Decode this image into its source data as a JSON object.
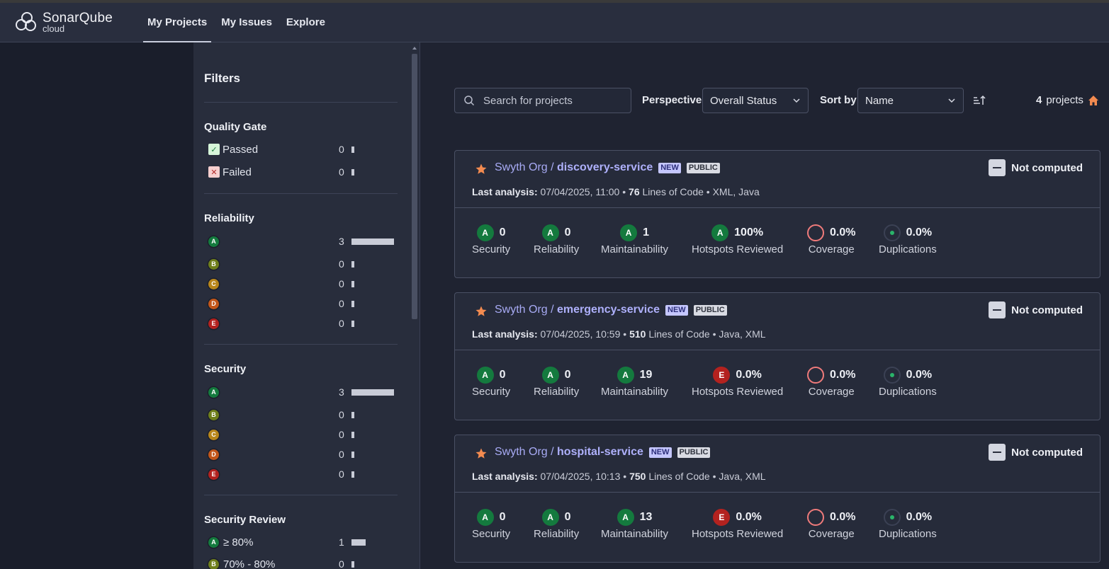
{
  "app": {
    "name": "SonarQube",
    "sub": "cloud"
  },
  "nav": [
    {
      "label": "My Projects",
      "active": true
    },
    {
      "label": "My Issues",
      "active": false
    },
    {
      "label": "Explore",
      "active": false
    }
  ],
  "filters": {
    "title": "Filters",
    "quality_gate": {
      "title": "Quality Gate",
      "items": [
        {
          "label": "Passed",
          "count": "0",
          "fraction": 0
        },
        {
          "label": "Failed",
          "count": "0",
          "fraction": 0
        }
      ]
    },
    "reliability": {
      "title": "Reliability",
      "items": [
        {
          "grade": "A",
          "count": "3",
          "fraction": 1
        },
        {
          "grade": "B",
          "count": "0",
          "fraction": 0
        },
        {
          "grade": "C",
          "count": "0",
          "fraction": 0
        },
        {
          "grade": "D",
          "count": "0",
          "fraction": 0
        },
        {
          "grade": "E",
          "count": "0",
          "fraction": 0
        }
      ]
    },
    "security": {
      "title": "Security",
      "items": [
        {
          "grade": "A",
          "count": "3",
          "fraction": 1
        },
        {
          "grade": "B",
          "count": "0",
          "fraction": 0
        },
        {
          "grade": "C",
          "count": "0",
          "fraction": 0
        },
        {
          "grade": "D",
          "count": "0",
          "fraction": 0
        },
        {
          "grade": "E",
          "count": "0",
          "fraction": 0
        }
      ]
    },
    "security_review": {
      "title": "Security Review",
      "items": [
        {
          "grade": "A",
          "label": "≥ 80%",
          "count": "1",
          "fraction": 0.33
        },
        {
          "grade": "B",
          "label": "70% - 80%",
          "count": "0",
          "fraction": 0
        }
      ]
    }
  },
  "toolbar": {
    "search_placeholder": "Search for projects",
    "perspective_label": "Perspective",
    "perspective_value": "Overall Status",
    "sort_label": "Sort by",
    "sort_value": "Name",
    "count_value": "4",
    "count_suffix": "projects"
  },
  "projects": [
    {
      "org": "Swyth Org",
      "name": "discovery-service",
      "tags": [
        "NEW",
        "PUBLIC"
      ],
      "status": "Not computed",
      "analysis_label": "Last analysis:",
      "analysis_date": "07/04/2025, 11:00",
      "loc": "76",
      "loc_label": "Lines of Code",
      "languages": "XML, Java",
      "security": {
        "grade": "A",
        "value": "0",
        "label": "Security"
      },
      "reliability": {
        "grade": "A",
        "value": "0",
        "label": "Reliability"
      },
      "maintainability": {
        "grade": "A",
        "value": "1",
        "label": "Maintainability"
      },
      "hotspots": {
        "grade": "A",
        "value": "100%",
        "label": "Hotspots Reviewed"
      },
      "coverage": {
        "value": "0.0%",
        "label": "Coverage"
      },
      "duplications": {
        "value": "0.0%",
        "label": "Duplications"
      }
    },
    {
      "org": "Swyth Org",
      "name": "emergency-service",
      "tags": [
        "NEW",
        "PUBLIC"
      ],
      "status": "Not computed",
      "analysis_label": "Last analysis:",
      "analysis_date": "07/04/2025, 10:59",
      "loc": "510",
      "loc_label": "Lines of Code",
      "languages": "Java, XML",
      "security": {
        "grade": "A",
        "value": "0",
        "label": "Security"
      },
      "reliability": {
        "grade": "A",
        "value": "0",
        "label": "Reliability"
      },
      "maintainability": {
        "grade": "A",
        "value": "19",
        "label": "Maintainability"
      },
      "hotspots": {
        "grade": "E",
        "value": "0.0%",
        "label": "Hotspots Reviewed"
      },
      "coverage": {
        "value": "0.0%",
        "label": "Coverage"
      },
      "duplications": {
        "value": "0.0%",
        "label": "Duplications"
      }
    },
    {
      "org": "Swyth Org",
      "name": "hospital-service",
      "tags": [
        "NEW",
        "PUBLIC"
      ],
      "status": "Not computed",
      "analysis_label": "Last analysis:",
      "analysis_date": "07/04/2025, 10:13",
      "loc": "750",
      "loc_label": "Lines of Code",
      "languages": "Java, XML",
      "security": {
        "grade": "A",
        "value": "0",
        "label": "Security"
      },
      "reliability": {
        "grade": "A",
        "value": "0",
        "label": "Reliability"
      },
      "maintainability": {
        "grade": "A",
        "value": "13",
        "label": "Maintainability"
      },
      "hotspots": {
        "grade": "E",
        "value": "0.0%",
        "label": "Hotspots Reviewed"
      },
      "coverage": {
        "value": "0.0%",
        "label": "Coverage"
      },
      "duplications": {
        "value": "0.0%",
        "label": "Duplications"
      }
    }
  ]
}
